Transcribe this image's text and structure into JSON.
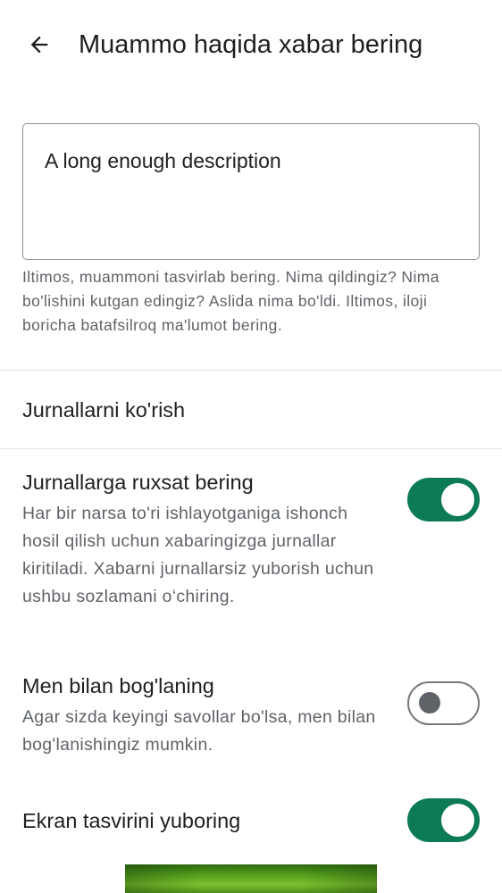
{
  "header": {
    "title": "Muammo haqida xabar bering",
    "back_icon": "arrow-back-icon"
  },
  "description": {
    "value": "A long enough description",
    "helper": "Iltimos, muammoni tasvirlab bering. Nima qildingiz? Nima bo'lishini kutgan edingiz? Aslida nima bo'ldi. Iltimos, iloji boricha batafsilroq ma'lumot bering."
  },
  "logs": {
    "view_label": "Jurnallarni ko'rish"
  },
  "settings": [
    {
      "title": "Jurnallarga ruxsat bering",
      "subtitle": "Har bir narsa to'ri ishlayotganiga ishonch hosil qilish uchun xabaringizga jurnallar kiritiladi. Xabarni jurnallarsiz yuborish uchun ushbu sozlamani o‘chiring.",
      "enabled": true
    },
    {
      "title": "Men bilan bog'laning",
      "subtitle": "Agar sizda keyingi savollar bo'lsa, men bilan bog'lanishingiz mumkin.",
      "enabled": false
    },
    {
      "title": "Ekran tasvirini yuboring",
      "subtitle": "",
      "enabled": true
    }
  ],
  "colors": {
    "accent": "#0b7a55",
    "text_primary": "#1f1f1f",
    "text_secondary": "#5f6368"
  }
}
